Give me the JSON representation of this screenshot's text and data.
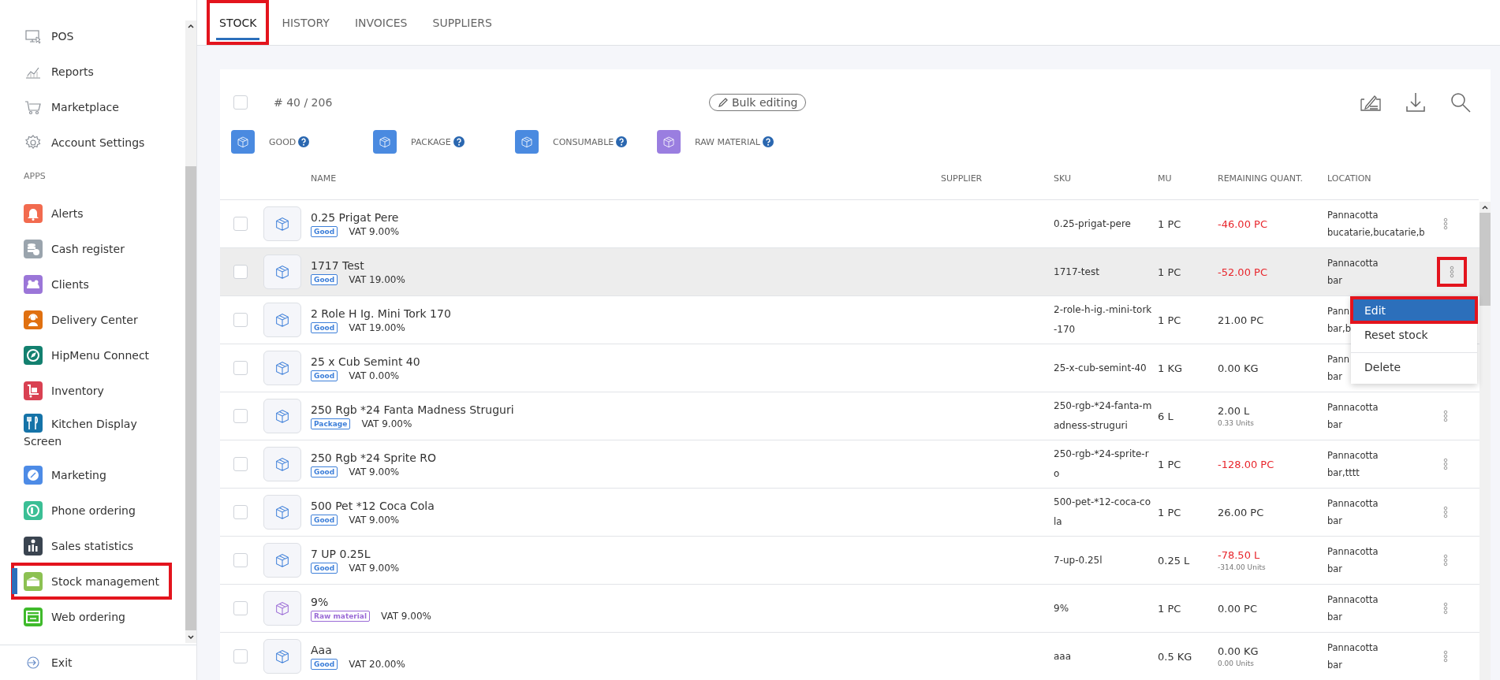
{
  "sidebar": {
    "links": [
      {
        "label": "POS"
      },
      {
        "label": "Reports"
      },
      {
        "label": "Marketplace"
      },
      {
        "label": "Account Settings"
      }
    ],
    "section_label": "APPS",
    "apps": [
      {
        "label": "Alerts",
        "color": "#f26b4f",
        "selected": false,
        "annotated": false
      },
      {
        "label": "Cash register",
        "color": "#9aa4ad",
        "selected": false,
        "annotated": false
      },
      {
        "label": "Clients",
        "color": "#9b76d8",
        "selected": false,
        "annotated": false
      },
      {
        "label": "Delivery Center",
        "color": "#e07010",
        "selected": false,
        "annotated": false
      },
      {
        "label": "HipMenu Connect",
        "color": "#13806f",
        "selected": false,
        "annotated": false
      },
      {
        "label": "Inventory",
        "color": "#d94152",
        "selected": false,
        "annotated": false
      },
      {
        "label": "Kitchen Display Screen",
        "color": "#1573a8",
        "selected": false,
        "annotated": false
      },
      {
        "label": "Marketing",
        "color": "#4d8be6",
        "selected": false,
        "annotated": false
      },
      {
        "label": "Phone ordering",
        "color": "#3bbf95",
        "selected": false,
        "annotated": false
      },
      {
        "label": "Sales statistics",
        "color": "#3a4450",
        "selected": false,
        "annotated": false
      },
      {
        "label": "Stock management",
        "color": "#8cc152",
        "selected": true,
        "annotated": true
      },
      {
        "label": "Web ordering",
        "color": "#3fba2b",
        "selected": false,
        "annotated": false
      }
    ],
    "exit": {
      "label": "Exit"
    }
  },
  "tabs": [
    {
      "label": "STOCK",
      "selected": true,
      "annotated": true
    },
    {
      "label": "HISTORY",
      "selected": false,
      "annotated": false
    },
    {
      "label": "INVOICES",
      "selected": false,
      "annotated": false
    },
    {
      "label": "SUPPLIERS",
      "selected": false,
      "annotated": false
    }
  ],
  "toolbar": {
    "select_all_checked": false,
    "count": "# 40 / 206",
    "bulk_button": "Bulk editing"
  },
  "legend": [
    {
      "label": "GOOD",
      "kind": "good"
    },
    {
      "label": "PACKAGE",
      "kind": "package"
    },
    {
      "label": "CONSUMABLE",
      "kind": "consumable"
    },
    {
      "label": "RAW MATERIAL",
      "kind": "raw_material"
    }
  ],
  "table": {
    "columns": [
      "NAME",
      "SUPPLIER",
      "SKU",
      "MU",
      "REMAINING QUANT.",
      "LOCATION"
    ],
    "rows": [
      {
        "checked": false,
        "name": "0.25 Prigat Pere",
        "type": {
          "label": "Good",
          "kind": "good"
        },
        "vat": "VAT 9.00%",
        "sku": "0.25-prigat-pere",
        "mu": "1 PC",
        "remaining": "-46.00 PC",
        "negative": true,
        "location": [
          "Pannacotta",
          "bucatarie,bucatarie,b"
        ],
        "hovered": false
      },
      {
        "checked": false,
        "name": "1717 Test",
        "type": {
          "label": "Good",
          "kind": "good"
        },
        "vat": "VAT 19.00%",
        "sku": "1717-test",
        "mu": "1 PC",
        "remaining": "-52.00 PC",
        "negative": true,
        "location": [
          "Pannacotta",
          "bar"
        ],
        "hovered": true,
        "annotated": true,
        "menu": {
          "items": [
            {
              "label": "Edit",
              "selected": true,
              "annotated": true,
              "separated": false
            },
            {
              "label": "Reset stock",
              "selected": false,
              "annotated": false,
              "separated": false
            },
            {
              "label": "Delete",
              "selected": false,
              "annotated": false,
              "separated": true
            }
          ]
        }
      },
      {
        "checked": false,
        "name": "2 Role H Ig. Mini Tork 170",
        "type": {
          "label": "Good",
          "kind": "good"
        },
        "vat": "VAT 19.00%",
        "sku": "2-role-h-ig.-mini-tork-170",
        "mu": "1 PC",
        "remaining": "21.00 PC",
        "negative": false,
        "location": [
          "Pann",
          "bar,b"
        ],
        "more_button": false,
        "hovered": false
      },
      {
        "checked": false,
        "name": "25 x Cub Semint 40",
        "type": {
          "label": "Good",
          "kind": "good"
        },
        "vat": "VAT 0.00%",
        "sku": "25-x-cub-semint-40",
        "mu": "1 KG",
        "remaining": "0.00 KG",
        "negative": false,
        "location": [
          "Pann",
          "bar"
        ],
        "more_button": false,
        "hovered": false
      },
      {
        "checked": false,
        "name": "250 Rgb *24 Fanta Madness Struguri",
        "type": {
          "label": "Package",
          "kind": "package"
        },
        "vat": "VAT 9.00%",
        "sku": "250-rgb-*24-fanta-madness-struguri",
        "mu": "6 L",
        "remaining": "2.00 L",
        "units": "0.33 Units",
        "negative": false,
        "location": [
          "Pannacotta",
          "bar"
        ],
        "hovered": false
      },
      {
        "checked": false,
        "name": "250 Rgb *24 Sprite RO",
        "type": {
          "label": "Good",
          "kind": "good"
        },
        "vat": "VAT 9.00%",
        "sku": "250-rgb-*24-sprite-ro",
        "mu": "1 PC",
        "remaining": "-128.00 PC",
        "negative": true,
        "location": [
          "Pannacotta",
          "bar,tttt"
        ],
        "hovered": false
      },
      {
        "checked": false,
        "name": "500 Pet *12 Coca Cola",
        "type": {
          "label": "Good",
          "kind": "good"
        },
        "vat": "VAT 9.00%",
        "sku": "500-pet-*12-coca-cola",
        "mu": "1 PC",
        "remaining": "26.00 PC",
        "negative": false,
        "location": [
          "Pannacotta",
          "bar"
        ],
        "hovered": false
      },
      {
        "checked": false,
        "name": "7 UP 0.25L",
        "type": {
          "label": "Good",
          "kind": "good"
        },
        "vat": "VAT 9.00%",
        "sku": "7-up-0.25l",
        "mu": "0.25 L",
        "remaining": "-78.50 L",
        "units": "-314.00 Units",
        "negative": true,
        "location": [
          "Pannacotta",
          "bar"
        ],
        "hovered": false
      },
      {
        "checked": false,
        "name": "9%",
        "type": {
          "label": "Raw material",
          "kind": "raw_material"
        },
        "vat": "VAT 9.00%",
        "sku": "9%",
        "mu": "1 PC",
        "remaining": "0.00 PC",
        "negative": false,
        "location": [
          "Pannacotta",
          "bar"
        ],
        "hovered": false
      },
      {
        "checked": false,
        "name": "Aaa",
        "type": {
          "label": "Good",
          "kind": "good"
        },
        "vat": "VAT 20.00%",
        "sku": "aaa",
        "mu": "0.5 KG",
        "remaining": "0.00 KG",
        "units": "0.00 Units",
        "negative": false,
        "location": [
          "Pannacotta",
          "bar"
        ],
        "hovered": false
      }
    ]
  }
}
